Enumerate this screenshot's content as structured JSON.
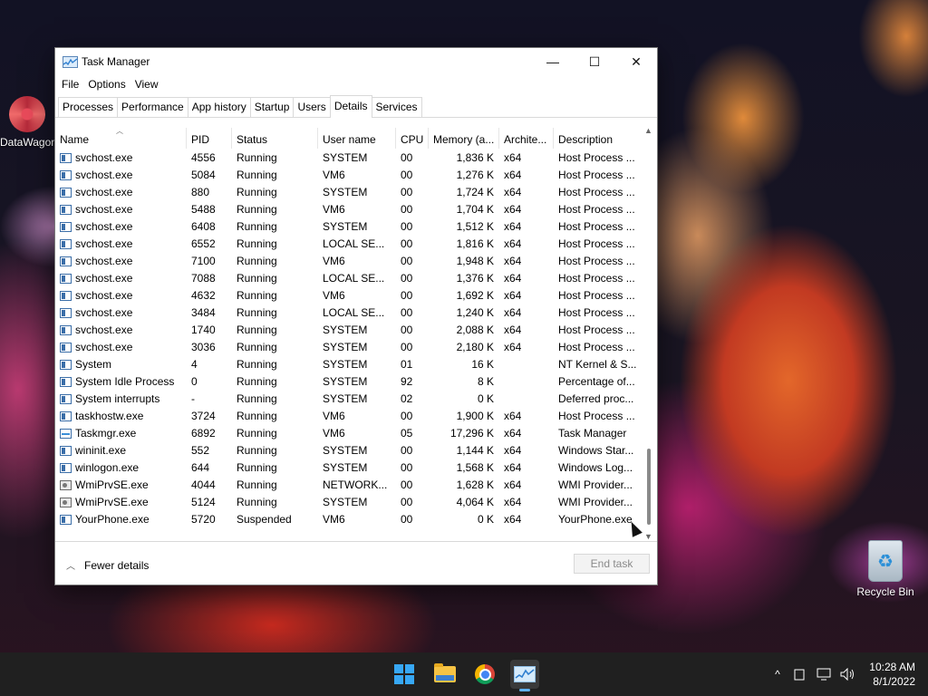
{
  "desktop": {
    "icons": [
      {
        "label": "DataWagon"
      },
      {
        "label": "Recycle Bin"
      }
    ]
  },
  "window": {
    "title": "Task Manager",
    "controls": {
      "minimize": "—",
      "maximize": "☐",
      "close": "✕"
    }
  },
  "menu": [
    "File",
    "Options",
    "View"
  ],
  "tabs": [
    "Processes",
    "Performance",
    "App history",
    "Startup",
    "Users",
    "Details",
    "Services"
  ],
  "active_tab": "Details",
  "table": {
    "columns": [
      "Name",
      "PID",
      "Status",
      "User name",
      "CPU",
      "Memory (a...",
      "Archite...",
      "Description"
    ],
    "rows": [
      [
        "svchost.exe",
        "4556",
        "Running",
        "SYSTEM",
        "00",
        "1,836 K",
        "x64",
        "Host Process ..."
      ],
      [
        "svchost.exe",
        "5084",
        "Running",
        "VM6",
        "00",
        "1,276 K",
        "x64",
        "Host Process ..."
      ],
      [
        "svchost.exe",
        "880",
        "Running",
        "SYSTEM",
        "00",
        "1,724 K",
        "x64",
        "Host Process ..."
      ],
      [
        "svchost.exe",
        "5488",
        "Running",
        "VM6",
        "00",
        "1,704 K",
        "x64",
        "Host Process ..."
      ],
      [
        "svchost.exe",
        "6408",
        "Running",
        "SYSTEM",
        "00",
        "1,512 K",
        "x64",
        "Host Process ..."
      ],
      [
        "svchost.exe",
        "6552",
        "Running",
        "LOCAL SE...",
        "00",
        "1,816 K",
        "x64",
        "Host Process ..."
      ],
      [
        "svchost.exe",
        "7100",
        "Running",
        "VM6",
        "00",
        "1,948 K",
        "x64",
        "Host Process ..."
      ],
      [
        "svchost.exe",
        "7088",
        "Running",
        "LOCAL SE...",
        "00",
        "1,376 K",
        "x64",
        "Host Process ..."
      ],
      [
        "svchost.exe",
        "4632",
        "Running",
        "VM6",
        "00",
        "1,692 K",
        "x64",
        "Host Process ..."
      ],
      [
        "svchost.exe",
        "3484",
        "Running",
        "LOCAL SE...",
        "00",
        "1,240 K",
        "x64",
        "Host Process ..."
      ],
      [
        "svchost.exe",
        "1740",
        "Running",
        "SYSTEM",
        "00",
        "2,088 K",
        "x64",
        "Host Process ..."
      ],
      [
        "svchost.exe",
        "3036",
        "Running",
        "SYSTEM",
        "00",
        "2,180 K",
        "x64",
        "Host Process ..."
      ],
      [
        "System",
        "4",
        "Running",
        "SYSTEM",
        "01",
        "16 K",
        "",
        "NT Kernel & S..."
      ],
      [
        "System Idle Process",
        "0",
        "Running",
        "SYSTEM",
        "92",
        "8 K",
        "",
        "Percentage of..."
      ],
      [
        "System interrupts",
        "-",
        "Running",
        "SYSTEM",
        "02",
        "0 K",
        "",
        "Deferred proc..."
      ],
      [
        "taskhostw.exe",
        "3724",
        "Running",
        "VM6",
        "00",
        "1,900 K",
        "x64",
        "Host Process ..."
      ],
      [
        "Taskmgr.exe",
        "6892",
        "Running",
        "VM6",
        "05",
        "17,296 K",
        "x64",
        "Task Manager"
      ],
      [
        "wininit.exe",
        "552",
        "Running",
        "SYSTEM",
        "00",
        "1,144 K",
        "x64",
        "Windows Star..."
      ],
      [
        "winlogon.exe",
        "644",
        "Running",
        "SYSTEM",
        "00",
        "1,568 K",
        "x64",
        "Windows Log..."
      ],
      [
        "WmiPrvSE.exe",
        "4044",
        "Running",
        "NETWORK...",
        "00",
        "1,628 K",
        "x64",
        "WMI Provider..."
      ],
      [
        "WmiPrvSE.exe",
        "5124",
        "Running",
        "SYSTEM",
        "00",
        "4,064 K",
        "x64",
        "WMI Provider..."
      ],
      [
        "YourPhone.exe",
        "5720",
        "Suspended",
        "VM6",
        "00",
        "0 K",
        "x64",
        "YourPhone.exe"
      ]
    ],
    "row_icons": [
      "window-icon",
      "window-icon",
      "window-icon",
      "window-icon",
      "window-icon",
      "window-icon",
      "window-icon",
      "window-icon",
      "window-icon",
      "window-icon",
      "window-icon",
      "window-icon",
      "window-icon",
      "window-icon",
      "window-icon",
      "window-icon",
      "taskmgr-icon",
      "window-icon",
      "window-icon",
      "service-icon",
      "service-icon",
      "window-icon"
    ]
  },
  "footer": {
    "fewer_details": "Fewer details",
    "end_task": "End task"
  },
  "taskbar": {
    "apps": [
      "start-icon",
      "file-explorer-icon",
      "chrome-icon",
      "task-manager-icon"
    ],
    "tray": {
      "chevron": "^"
    },
    "time": "10:28 AM",
    "date": "8/1/2022"
  },
  "colors": {
    "accent": "#37a8f5",
    "taskbar": "#202020"
  }
}
